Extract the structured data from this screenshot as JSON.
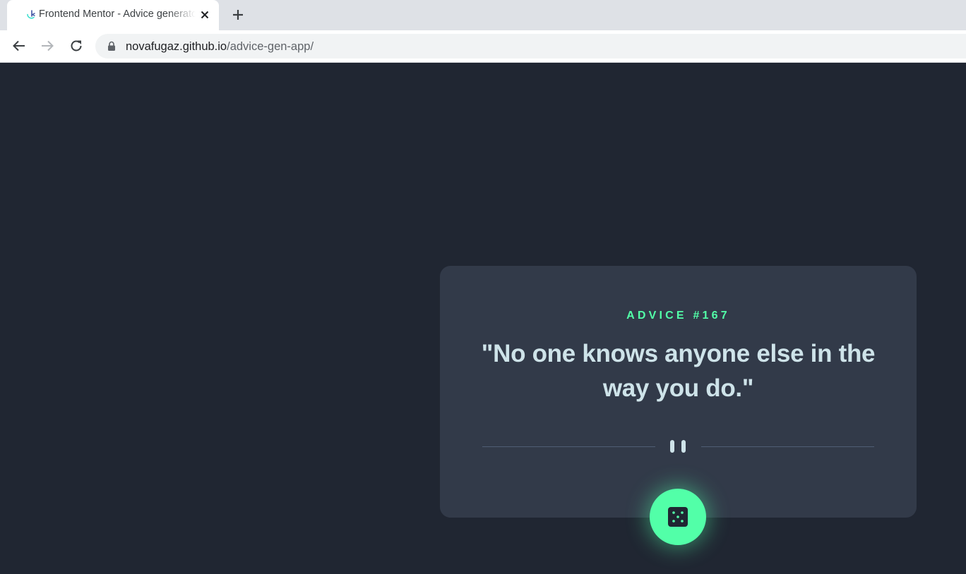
{
  "browser": {
    "tab": {
      "title": "Frontend Mentor - Advice generator app"
    },
    "address_bar": {
      "host": "novafugaz.github.io",
      "path": "/advice-gen-app/"
    },
    "icons": {
      "favicon": "frontend-mentor-icon",
      "close": "close-icon",
      "new_tab": "plus-icon",
      "back": "arrow-left-icon",
      "forward": "arrow-right-icon",
      "reload": "reload-icon",
      "lock": "lock-icon"
    }
  },
  "advice_card": {
    "heading": "ADVICE #167",
    "quote": "\"No one knows anyone else in the way you do.\"",
    "divider_icon": "pause-icon",
    "button_icon": "dice-icon"
  },
  "colors": {
    "page_background": "#202632",
    "card_background": "#323a49",
    "accent": "#52ffa8",
    "quote_text": "#cee3e9",
    "divider": "#4f5d74"
  }
}
